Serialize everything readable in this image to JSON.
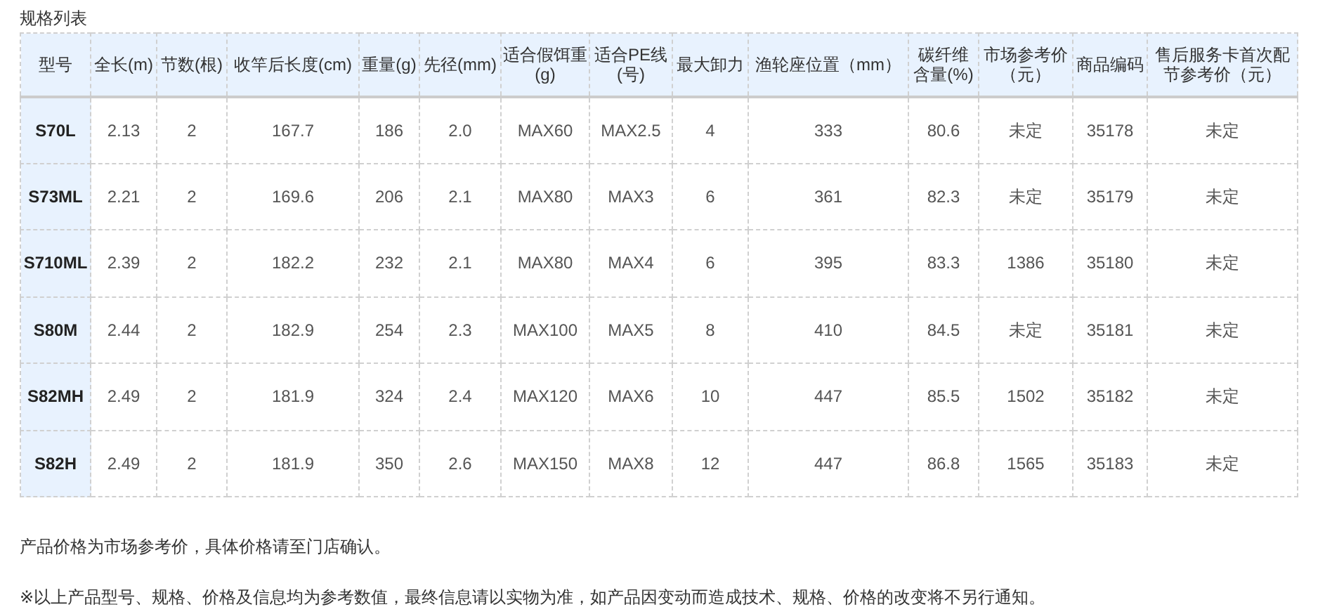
{
  "title": "规格列表",
  "table": {
    "columns": [
      "型号",
      "全长(m)",
      "节数(根)",
      "收竿后长度(cm)",
      "重量(g)",
      "先径(mm)",
      "适合假饵重(g)",
      "适合PE线(号)",
      "最大卸力",
      "渔轮座位置（mm）",
      "碳纤维含量(%)",
      "市场参考价（元）",
      "商品编码",
      "售后服务卡首次配节参考价（元）"
    ],
    "rows": [
      [
        "S70L",
        "2.13",
        "2",
        "167.7",
        "186",
        "2.0",
        "MAX60",
        "MAX2.5",
        "4",
        "333",
        "80.6",
        "未定",
        "35178",
        "未定"
      ],
      [
        "S73ML",
        "2.21",
        "2",
        "169.6",
        "206",
        "2.1",
        "MAX80",
        "MAX3",
        "6",
        "361",
        "82.3",
        "未定",
        "35179",
        "未定"
      ],
      [
        "S710ML",
        "2.39",
        "2",
        "182.2",
        "232",
        "2.1",
        "MAX80",
        "MAX4",
        "6",
        "395",
        "83.3",
        "1386",
        "35180",
        "未定"
      ],
      [
        "S80M",
        "2.44",
        "2",
        "182.9",
        "254",
        "2.3",
        "MAX100",
        "MAX5",
        "8",
        "410",
        "84.5",
        "未定",
        "35181",
        "未定"
      ],
      [
        "S82MH",
        "2.49",
        "2",
        "181.9",
        "324",
        "2.4",
        "MAX120",
        "MAX6",
        "10",
        "447",
        "85.5",
        "1502",
        "35182",
        "未定"
      ],
      [
        "S82H",
        "2.49",
        "2",
        "181.9",
        "350",
        "2.6",
        "MAX150",
        "MAX8",
        "12",
        "447",
        "86.8",
        "1565",
        "35183",
        "未定"
      ]
    ]
  },
  "notes": [
    "产品价格为市场参考价，具体价格请至门店确认。",
    "※以上产品型号、规格、价格及信息均为参考数值，最终信息请以实物为准，如产品因变动而造成技术、规格、价格的改变将不另行通知。"
  ]
}
